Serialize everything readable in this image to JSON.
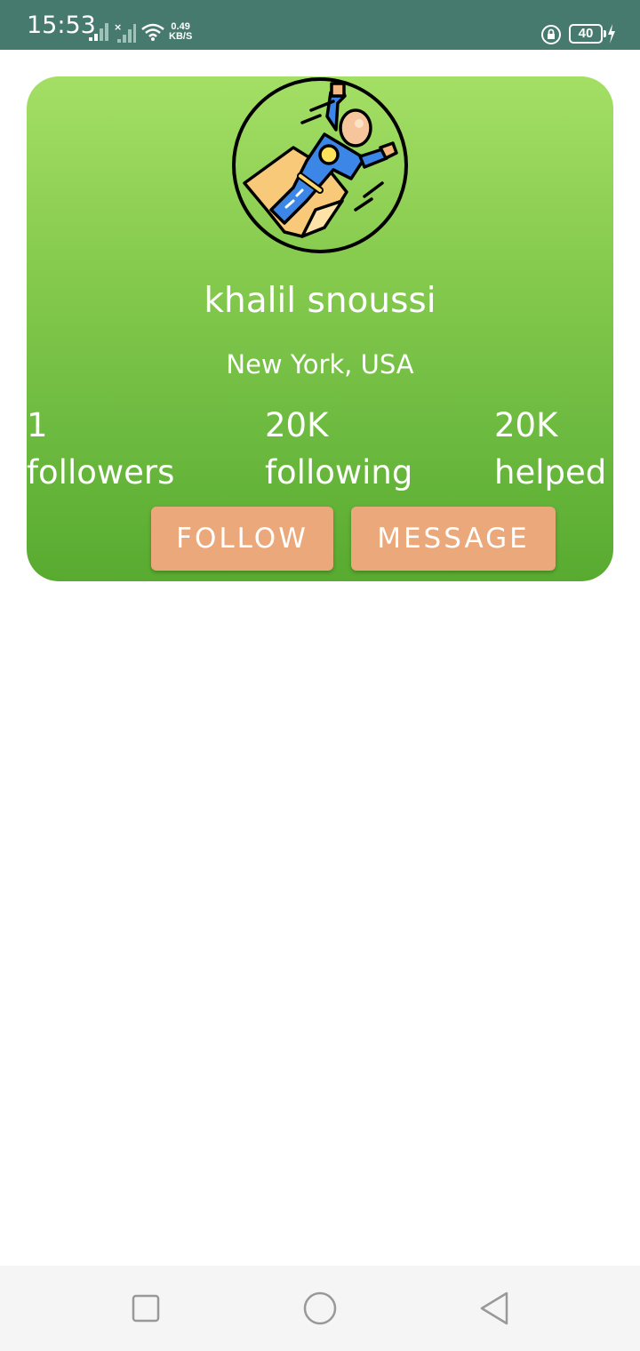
{
  "status_bar": {
    "time": "15:53",
    "network_speed_value": "0.49",
    "network_speed_unit": "KB/S",
    "battery_level": "40",
    "icons": [
      "signal-icon",
      "signal-no-service-icon",
      "wifi-icon",
      "rotation-lock-icon",
      "battery-icon",
      "charging-icon"
    ]
  },
  "profile": {
    "name": "khalil snoussi",
    "location": "New York, USA",
    "avatar_icon": "superhero-avatar-icon",
    "stats": [
      {
        "value": "1",
        "label": "followers"
      },
      {
        "value": "20K",
        "label": "following"
      },
      {
        "value": "20K",
        "label": "helped"
      }
    ],
    "follow_label": "FOLLOW",
    "message_label": "MESSAGE"
  },
  "nav_bar": {
    "icons": [
      "recent-apps-icon",
      "home-icon",
      "back-icon"
    ]
  },
  "colors": {
    "status_bar": "#477a6e",
    "card_top": "#a4df65",
    "card_bottom": "#58ab30",
    "button": "#eba87b",
    "nav_bar": "#f5f5f5"
  }
}
